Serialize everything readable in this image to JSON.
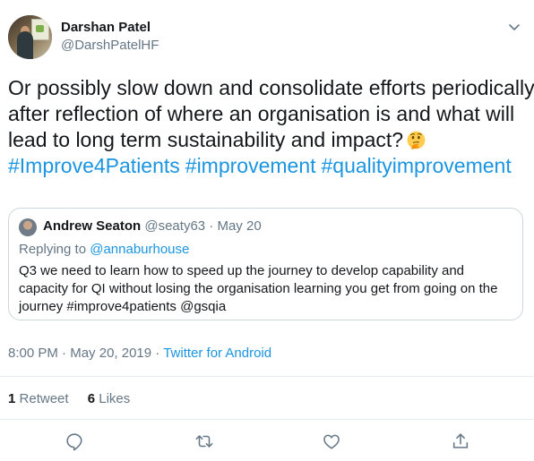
{
  "author": {
    "name": "Darshan Patel",
    "handle": "@DarshPatelHF"
  },
  "tweet": {
    "lines": [
      "Or possibly slow down and consolidate efforts periodically",
      "after reflection of where an organisation is and what will",
      "lead to long term sustainability and impact?"
    ],
    "emoji": "thinking-face",
    "hashtags": [
      "#Improve4Patients",
      "#improvement",
      "#qualityimprovement"
    ]
  },
  "quoted": {
    "name": "Andrew Seaton",
    "handle": "@seaty63",
    "separator": "·",
    "date": "May 20",
    "replying_prefix": "Replying to ",
    "replying_to": "@annaburhouse",
    "text": "Q3 we need to learn how to speed up the journey to develop capability and capacity for QI without losing the organisation learning you get from going on the journey #improve4patients @gsqia"
  },
  "meta": {
    "time": "8:00 PM",
    "separator": "·",
    "date": "May 20, 2019",
    "source": "Twitter for Android"
  },
  "stats": {
    "retweets_count": "1",
    "retweets_label": "Retweet",
    "likes_count": "6",
    "likes_label": "Likes"
  },
  "colors": {
    "link": "#1b95e0",
    "muted": "#657786",
    "text": "#14171a",
    "border": "#ccd6dd"
  },
  "icons": [
    "chevron-down-icon",
    "reply-icon",
    "retweet-icon",
    "like-icon",
    "share-icon"
  ]
}
